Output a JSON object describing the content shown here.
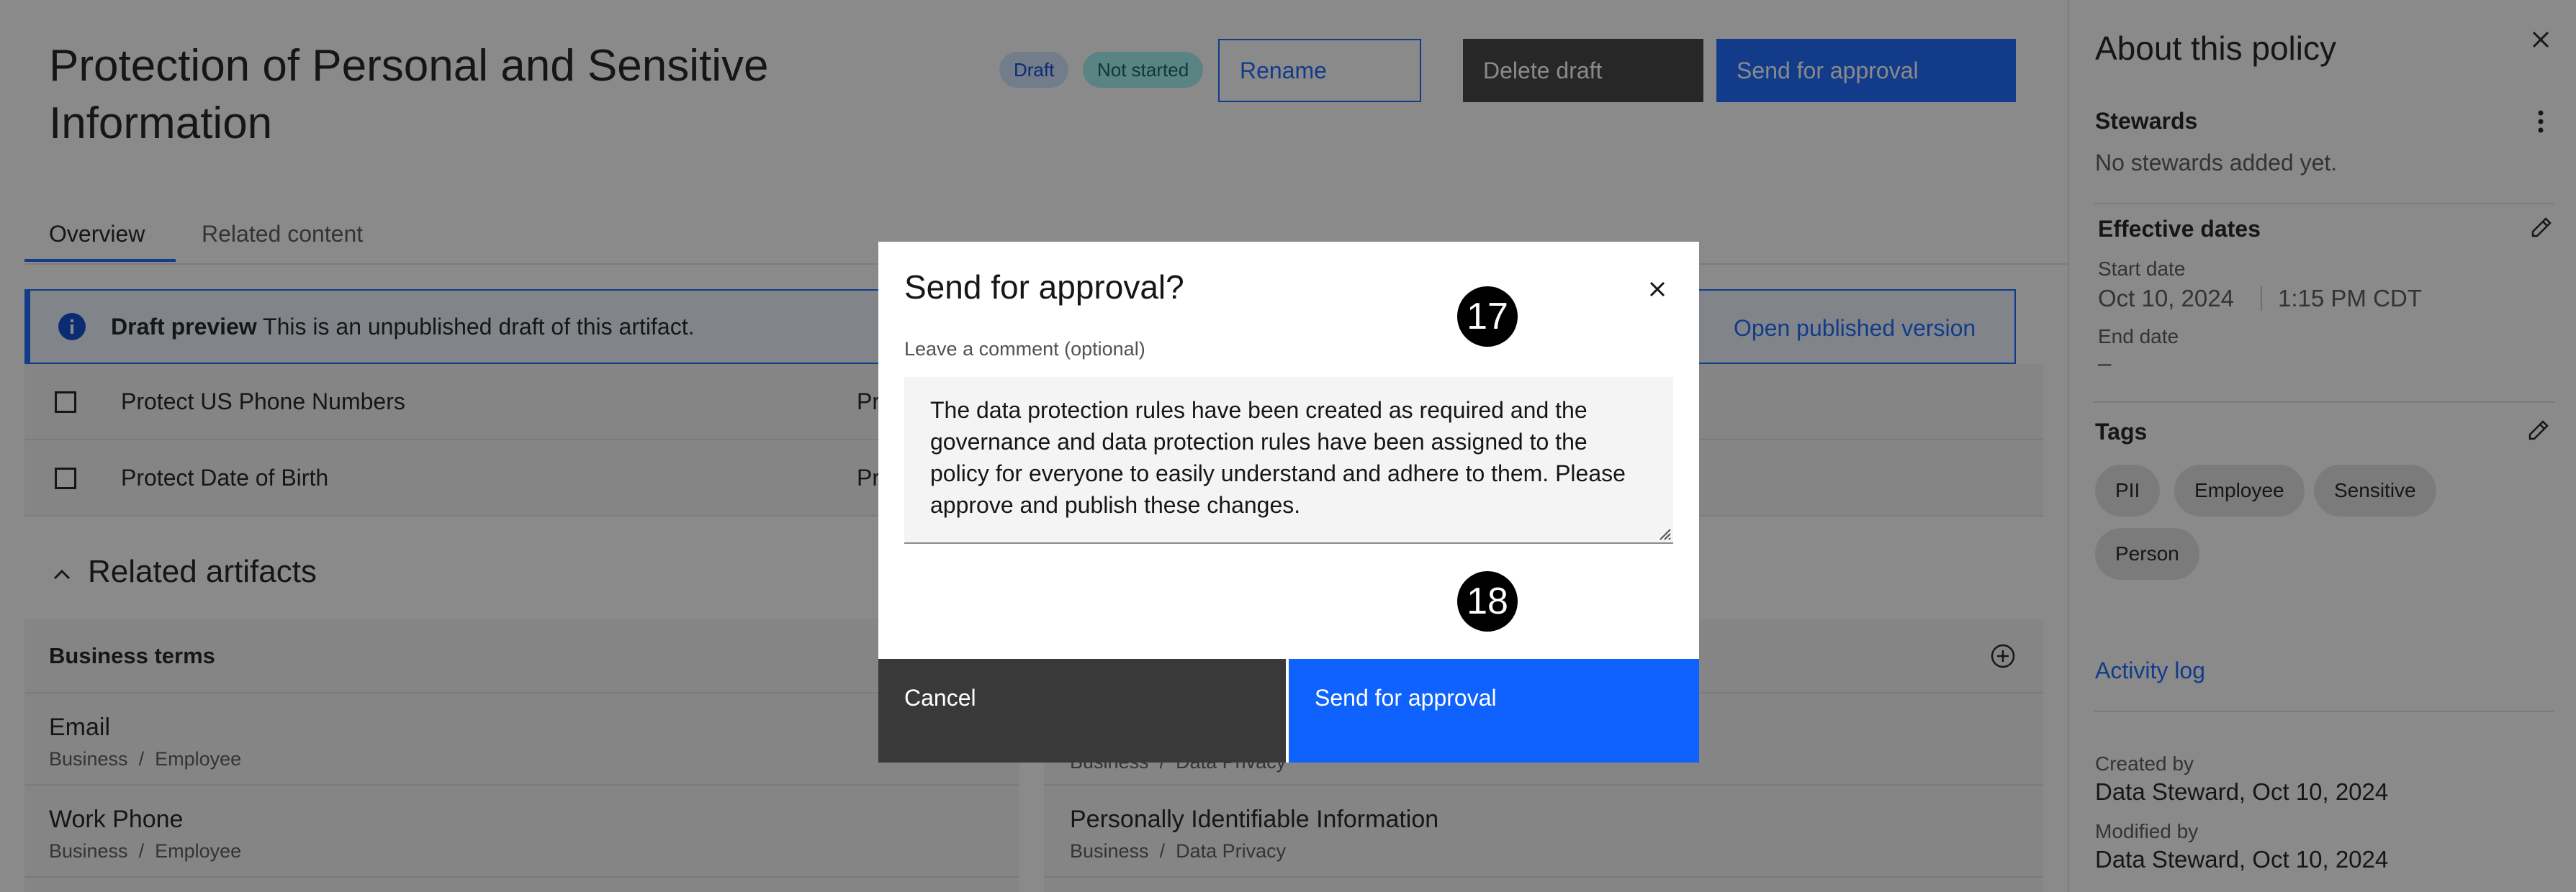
{
  "header": {
    "title": "Protection of Personal and Sensitive Information",
    "draft_tag": "Draft",
    "status_tag": "Not started",
    "rename_label": "Rename",
    "delete_label": "Delete draft",
    "send_label": "Send for approval"
  },
  "tabs": [
    {
      "label": "Overview"
    },
    {
      "label": "Related content"
    }
  ],
  "banner": {
    "title": "Draft preview",
    "text": "This is an unpublished draft of this artifact.",
    "link": "Open published version"
  },
  "rules": [
    {
      "label": "Protect US Phone Numbers",
      "col": "Pr"
    },
    {
      "label": "Protect Date of Birth",
      "col": "Pr"
    }
  ],
  "related": {
    "heading": "Related artifacts",
    "business_terms": {
      "title": "Business terms",
      "items": [
        {
          "name": "Email",
          "path1": "Business",
          "path2": "Employee"
        },
        {
          "name": "Work Phone",
          "path1": "Business",
          "path2": "Employee"
        }
      ]
    },
    "right_items": [
      {
        "name": "",
        "path1": "Business",
        "path2": "Data Privacy"
      },
      {
        "name": "Personally Identifiable Information",
        "path1": "Business",
        "path2": "Data Privacy"
      }
    ]
  },
  "sidebar": {
    "title": "About this policy",
    "stewards_heading": "Stewards",
    "stewards_text": "No stewards added yet.",
    "dates_heading": "Effective dates",
    "start_label": "Start date",
    "start_date": "Oct 10, 2024",
    "start_time": "1:15 PM CDT",
    "end_label": "End date",
    "end_value": "–",
    "tags_heading": "Tags",
    "tags": [
      "PII",
      "Employee",
      "Sensitive",
      "Person"
    ],
    "activity_link": "Activity log",
    "created_label": "Created by",
    "created_value": "Data Steward, Oct 10, 2024",
    "modified_label": "Modified by",
    "modified_value": "Data Steward, Oct 10, 2024"
  },
  "modal": {
    "title": "Send for approval?",
    "comment_label": "Leave a comment (optional)",
    "comment_value": "The data protection rules have been created as required and the governance and data protection rules have been assigned to the policy for everyone to easily understand and adhere to them. Please approve and publish these changes.",
    "cancel_label": "Cancel",
    "send_label": "Send for approval"
  },
  "markers": [
    "17",
    "18"
  ],
  "colors": {
    "primary": "#0f62fe",
    "dark_button": "#393939",
    "overlay": "rgba(22,22,22,0.5)",
    "draft_tag_bg": "#d0e2ff",
    "status_tag_bg": "#9ef0f0"
  },
  "icons": {
    "info": "info-icon",
    "close": "close-icon",
    "overflow": "overflow-menu-icon",
    "edit": "edit-icon",
    "chevron": "chevron-up-icon",
    "add": "add-circle-icon"
  }
}
